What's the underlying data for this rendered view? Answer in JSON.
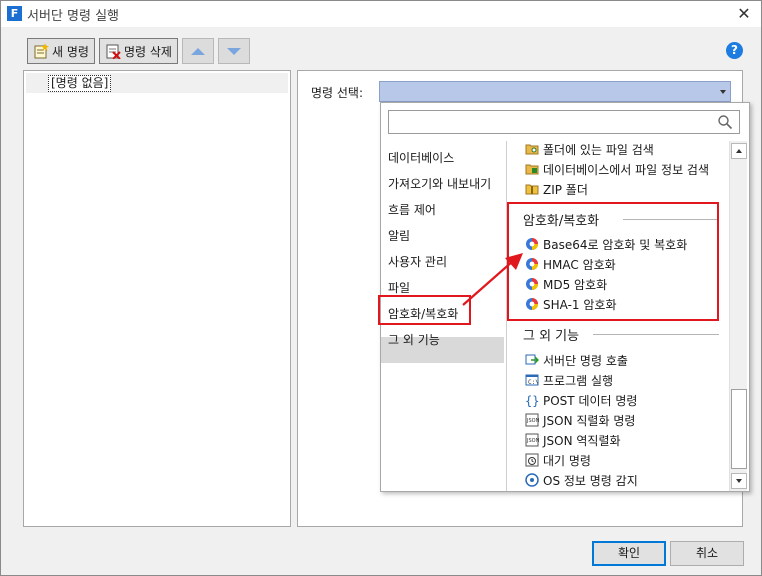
{
  "window": {
    "title": "서버단 명령 실행",
    "app_icon_letter": "F"
  },
  "toolbar": {
    "new_label": "새 명령",
    "delete_label": "명령 삭제"
  },
  "left_panel": {
    "empty_label": "[명령 없음]"
  },
  "right_panel": {
    "select_label": "명령 선택:"
  },
  "categories": [
    "데이터베이스",
    "가져오기와 내보내기",
    "흐름 제어",
    "알림",
    "사용자 관리",
    "파일",
    "암호화/복호화",
    "그 외 기능"
  ],
  "selected_category": "암호화/복호화",
  "file_items": [
    "폴더에 있는 파일 검색",
    "데이터베이스에서 파일 정보 검색",
    "ZIP 폴더"
  ],
  "crypto_section": {
    "header": "암호화/복호화",
    "items": [
      "Base64로 암호화 및 복호화",
      "HMAC 암호화",
      "MD5 암호화",
      "SHA-1 암호화"
    ]
  },
  "other_section": {
    "header": "그 외 기능",
    "items": [
      "서버단 명령 호출",
      "프로그램 실행",
      "POST 데이터 명령",
      "JSON 직렬화 명령",
      "JSON 역직렬화",
      "대기 명령",
      "OS 정보 명령 감지"
    ]
  },
  "buttons": {
    "ok": "확인",
    "cancel": "취소"
  },
  "colors": {
    "highlight_red": "#e0181e",
    "accent_blue": "#1c7ce0",
    "combo_blue": "#b8c8e8"
  }
}
